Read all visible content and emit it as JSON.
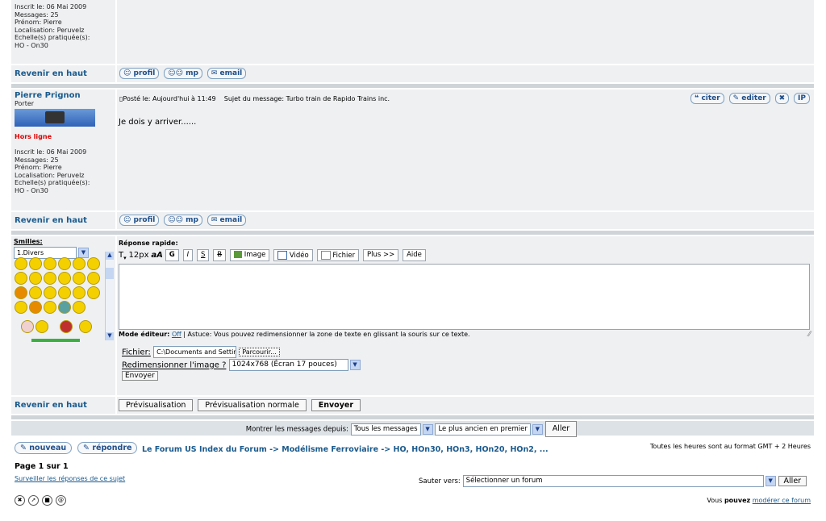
{
  "post1": {
    "userinfo_lines": [
      "Inscrit le: 06 Mai 2009",
      "Messages: 25",
      "Prénom: Pierre",
      "Localisation: Peruvelz",
      "Echelle(s) pratiquée(s):",
      "HO - On30"
    ],
    "revenir": "Revenir en haut",
    "btn_profil": "profil",
    "btn_mp": "mp",
    "btn_email": "email"
  },
  "post2": {
    "author": "Pierre Prignon",
    "rank": "Porter",
    "status": "Hors ligne",
    "userinfo_lines": [
      "Inscrit le: 06 Mai 2009",
      "Messages: 25",
      "Prénom: Pierre",
      "Localisation: Peruvelz",
      "Echelle(s) pratiquée(s):",
      "HO - On30"
    ],
    "posted": "Posté le: Aujourd'hui à 11:49",
    "subject": "Sujet du message: Turbo train de Rapido Trains inc.",
    "btn_citer": "citer",
    "btn_editer": "editer",
    "btn_ip": "IP",
    "body": "Je dois y arriver......",
    "revenir": "Revenir en haut",
    "btn_profil": "profil",
    "btn_mp": "mp",
    "btn_email": "email"
  },
  "reply": {
    "smilies_label": "Smilies:",
    "smilies_select": "1.Divers",
    "quick_reply_label": "Réponse rapide:",
    "toolbar": {
      "size": "12px",
      "bold": "G",
      "italic": "I",
      "underline": "S",
      "strike": "B",
      "image": "Image",
      "video": "Vidéo",
      "file": "Fichier",
      "more": "Plus >>",
      "help": "Aide"
    },
    "mode_label": "Mode éditeur:",
    "mode_value": "Off",
    "tip": "| Astuce: Vous pouvez redimensionner la zone de texte en glissant la souris sur ce texte.",
    "file_label": "Fichier:",
    "file_value": "C:\\Documents and Settir",
    "browse": "Parcourir...",
    "resize_label": "Redimensionner l'image ?",
    "resize_value": "1024x768 (Écran 17 pouces)",
    "send_small": "Envoyer",
    "revenir": "Revenir en haut",
    "preview": "Prévisualisation",
    "preview_normal": "Prévisualisation normale",
    "send": "Envoyer"
  },
  "filter": {
    "label": "Montrer les messages depuis:",
    "since": "Tous les messages",
    "order": "Le plus ancien en premier",
    "go": "Aller"
  },
  "footer": {
    "nouveau": "nouveau",
    "repondre": "répondre",
    "breadcrumb": "Le Forum US Index du Forum -> Modélisme Ferroviaire -> HO, HOn30, HOn3, HOn20, HOn2, ...",
    "timezone": "Toutes les heures sont au format GMT + 2 Heures",
    "page": "Page 1 sur 1",
    "watch": "Surveiller les réponses de ce sujet",
    "jump_label": "Sauter vers:",
    "jump_value": "Sélectionner un forum",
    "jump_go": "Aller",
    "moderate_prefix": "Vous",
    "moderate_bold": "pouvez",
    "moderate_link": "modérer ce forum"
  }
}
